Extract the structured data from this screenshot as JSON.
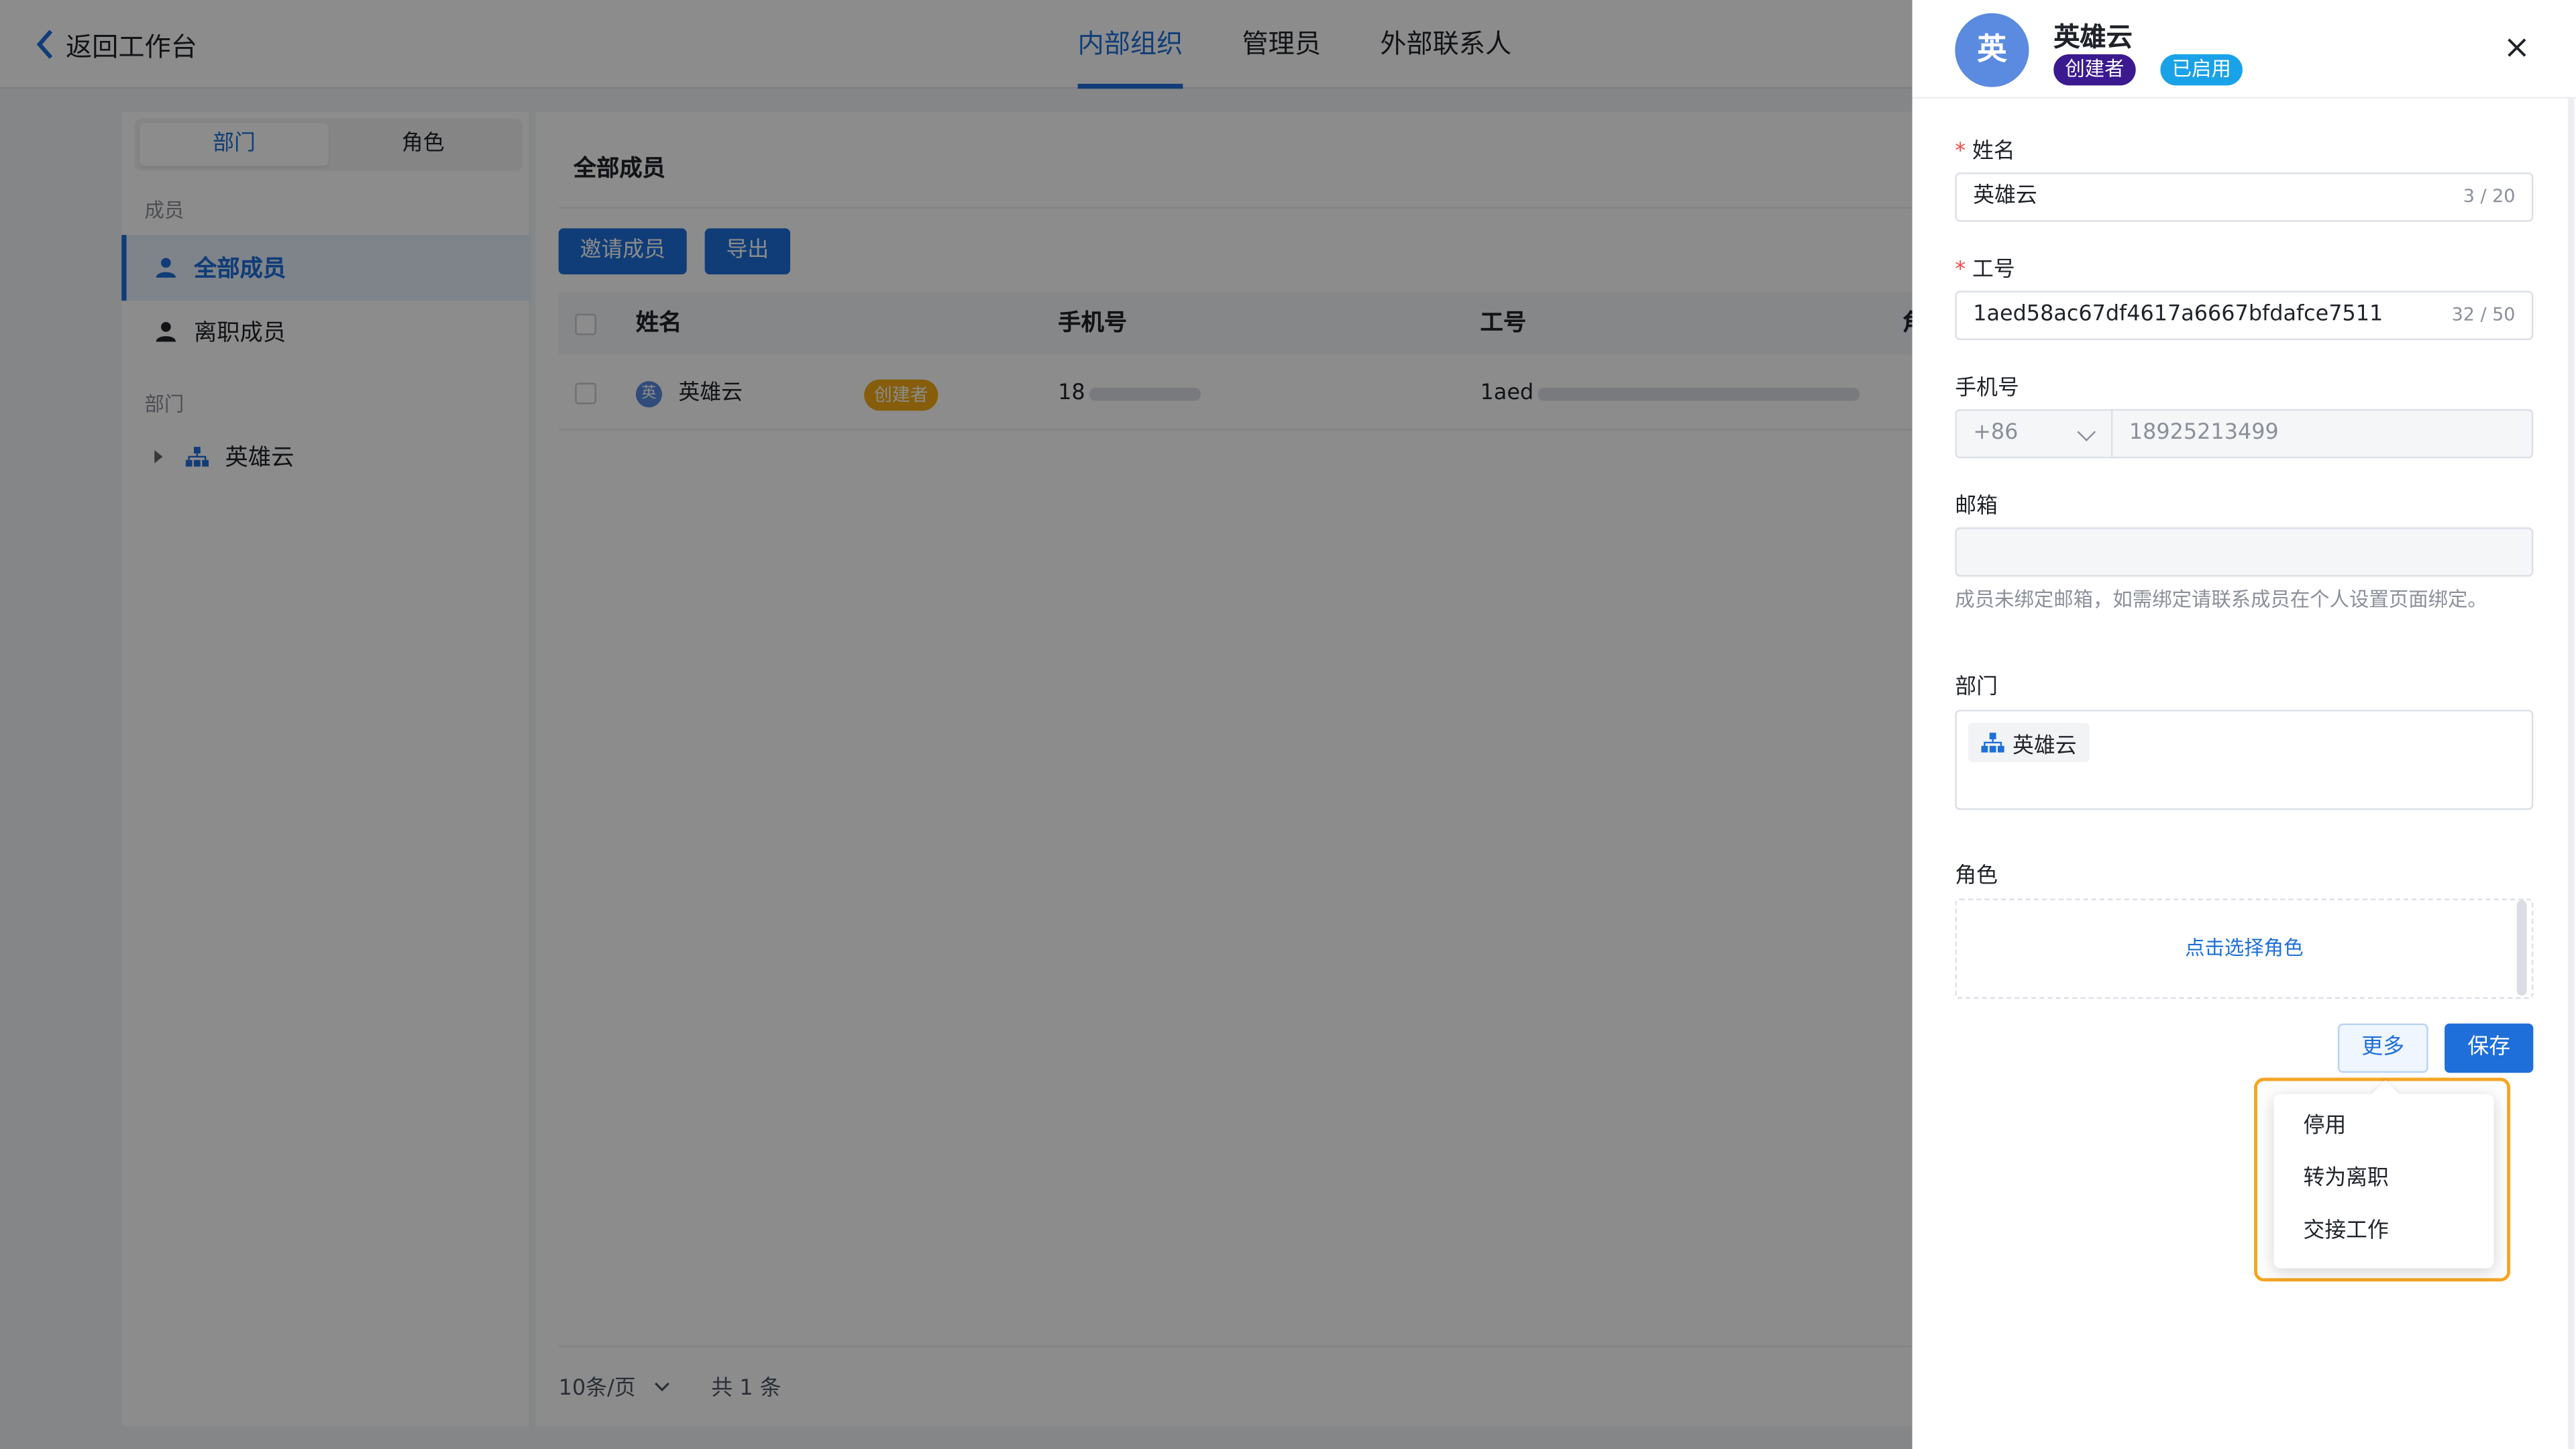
{
  "topbar": {
    "back_label": "返回工作台",
    "tabs": [
      {
        "label": "内部组织",
        "active": true
      },
      {
        "label": "管理员",
        "active": false
      },
      {
        "label": "外部联系人",
        "active": false
      }
    ]
  },
  "sidebar": {
    "segments": [
      "部门",
      "角色"
    ],
    "members_label": "成员",
    "items": [
      {
        "label": "全部成员",
        "icon": "user-icon",
        "active": true
      },
      {
        "label": "离职成员",
        "icon": "user-icon",
        "active": false
      }
    ],
    "dept_label": "部门",
    "tree": [
      {
        "label": "英雄云",
        "icon": "org-tree-icon"
      }
    ]
  },
  "main": {
    "title": "全部成员",
    "invite_button": "邀请成员",
    "export_button": "导出",
    "columns": [
      "姓名",
      "手机号",
      "工号",
      "角"
    ],
    "rows": [
      {
        "avatar": "英",
        "name": "英雄云",
        "tag": "创建者",
        "phone_prefix": "18",
        "id_prefix": "1aed"
      }
    ],
    "pager": {
      "page_size": "10条/页",
      "total": "共 1 条"
    }
  },
  "drawer": {
    "avatar_char": "英",
    "name": "英雄云",
    "badges": [
      {
        "label": "创建者",
        "color": "#3b1a8f"
      },
      {
        "label": "已启用",
        "color": "#19a2e8"
      }
    ],
    "fields": {
      "name_label": "姓名",
      "name_value": "英雄云",
      "name_count": "3 / 20",
      "id_label": "工号",
      "id_value": "1aed58ac67df4617a6667bfdafce7511",
      "id_count": "32 / 50",
      "phone_label": "手机号",
      "phone_code": "+86",
      "phone_value": "18925213499",
      "email_label": "邮箱",
      "email_value": "",
      "email_hint": "成员未绑定邮箱，如需绑定请联系成员在个人设置页面绑定。",
      "dept_label": "部门",
      "dept_value": "英雄云",
      "role_label": "角色",
      "role_placeholder": "点击选择角色"
    },
    "more_button": "更多",
    "save_button": "保存",
    "more_menu": [
      "停用",
      "转为离职",
      "交接工作"
    ]
  },
  "colors": {
    "accent": "#1e6fd9",
    "creator_tag": "#f3a915",
    "highlight_border": "#f5a524"
  }
}
